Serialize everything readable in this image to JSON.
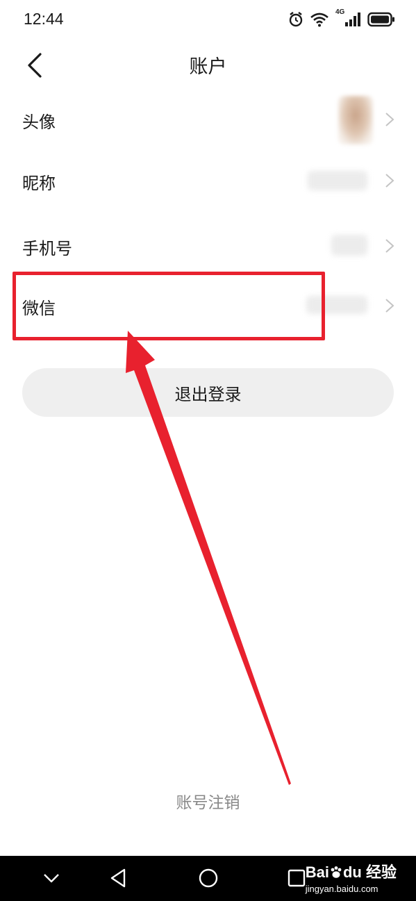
{
  "status_bar": {
    "time": "12:44",
    "signal_label": "4G",
    "icons": [
      "alarm-icon",
      "wifi-icon",
      "cellular-signal-icon",
      "battery-icon"
    ]
  },
  "header": {
    "title": "账户",
    "back_icon": "chevron-left-icon"
  },
  "rows": [
    {
      "label": "头像",
      "value_type": "avatar"
    },
    {
      "label": "昵称",
      "value_type": "blurred-text"
    },
    {
      "label": "手机号",
      "value_type": "blurred-text"
    },
    {
      "label": "微信",
      "value_type": "blurred-text",
      "highlighted": true
    }
  ],
  "logout_label": "退出登录",
  "cancel_account_label": "账号注销",
  "annotation": {
    "color": "#e8212e",
    "shapes": [
      "highlight-box",
      "arrow"
    ]
  },
  "nav_bar": {
    "buttons": [
      "chevron-down-icon",
      "back-triangle-icon",
      "home-circle-icon",
      "recents-square-icon"
    ]
  },
  "watermark": {
    "brand": "Bai",
    "brand2": "du",
    "product": "经验",
    "url": "jingyan.baidu.com"
  }
}
